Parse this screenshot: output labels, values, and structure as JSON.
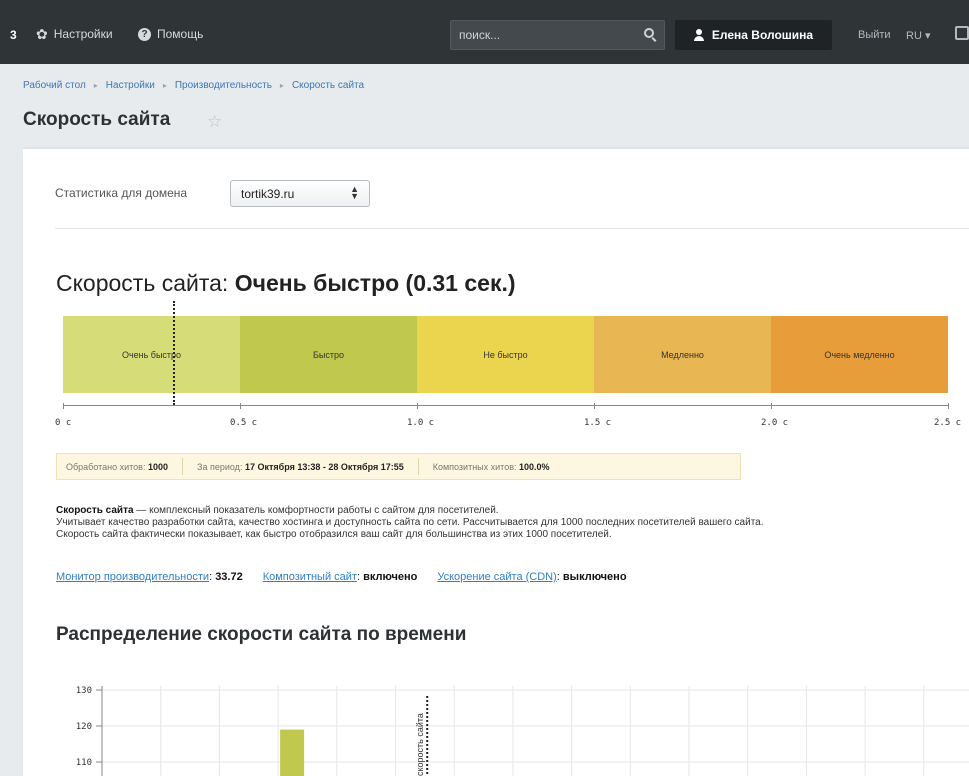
{
  "topbar": {
    "number": "3",
    "settings": "Настройки",
    "help": "Помощь",
    "search_placeholder": "поиск...",
    "user": "Елена Волошина",
    "logout": "Выйти",
    "lang": "RU"
  },
  "breadcrumbs": [
    "Рабочий стол",
    "Настройки",
    "Производительность",
    "Скорость сайта"
  ],
  "page_title": "Скорость сайта",
  "domain": {
    "label": "Статистика для домена",
    "value": "tortik39.ru"
  },
  "speed": {
    "label": "Скорость сайта:",
    "value": "Очень быстро (0.31 сек.)",
    "marker_seconds": 0.31,
    "bands": [
      {
        "label": "Очень быстро",
        "from": 0,
        "to": 0.5,
        "color": "#d6dd78"
      },
      {
        "label": "Быстро",
        "from": 0.5,
        "to": 1.0,
        "color": "#c0c94d"
      },
      {
        "label": "Не быстро",
        "from": 1.0,
        "to": 1.5,
        "color": "#ecd54e"
      },
      {
        "label": "Медленно",
        "from": 1.5,
        "to": 2.0,
        "color": "#e8b653"
      },
      {
        "label": "Очень медленно",
        "from": 2.0,
        "to": 2.5,
        "color": "#e89d3b"
      }
    ],
    "ticks": [
      "0 с",
      "0.5 с",
      "1.0 с",
      "1.5 с",
      "2.0 с",
      "2.5 с"
    ]
  },
  "stats": {
    "hits_label": "Обработано хитов:",
    "hits_value": "1000",
    "period_label": "За период:",
    "period_value": "17 Октября 13:38 - 28 Октября 17:55",
    "composite_label": "Композитных хитов:",
    "composite_value": "100.0%"
  },
  "description": {
    "bold": "Скорость сайта",
    "line1": " — комплексный показатель комфортности работы с сайтом для посетителей.",
    "line2": "Учитывает качество разработки сайта, качество хостинга и доступность сайта по сети. Рассчитывается для 1000 последних посетителей вашего сайта.",
    "line3": "Скорость сайта фактически показывает, как быстро отобразился ваш сайт для большинства из этих 1000 посетителей."
  },
  "links": {
    "monitor_link": "Монитор производительности",
    "monitor_value": "33.72",
    "composite_link": "Композитный сайт",
    "composite_value": "включено",
    "cdn_link": "Ускорение сайта (CDN)",
    "cdn_value": "выключено"
  },
  "distribution_title": "Распределение скорости сайта по времени",
  "chart_data": {
    "type": "bar",
    "y_ticks": [
      130,
      120,
      110
    ],
    "bars": [
      {
        "x_index": 3,
        "value": 119
      }
    ],
    "marker_label": "скорость сайта",
    "marker_index": 6,
    "color": "#c0c94d"
  }
}
